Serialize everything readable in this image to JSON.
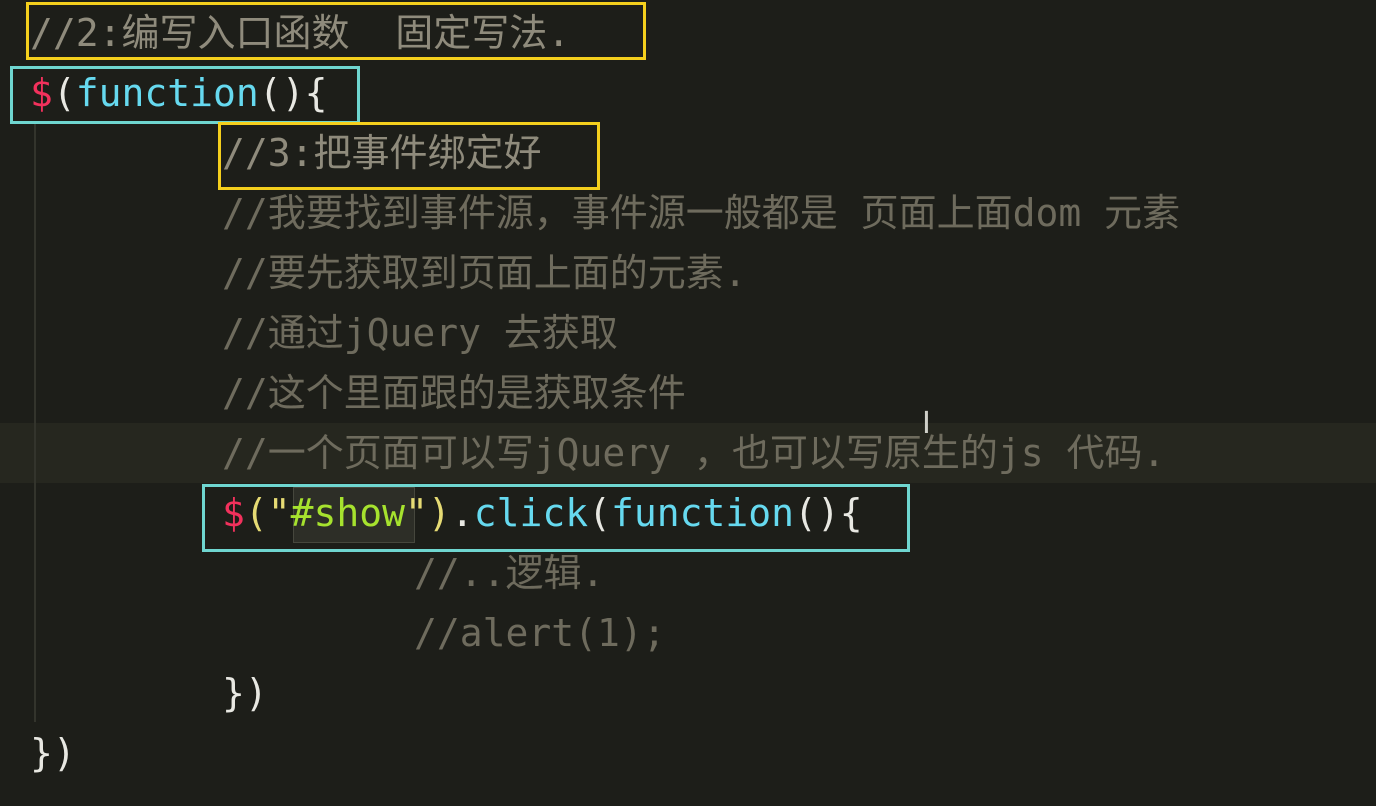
{
  "lines": [
    {
      "text": "//2:编写入口函数  固定写法.",
      "kind": "comment"
    },
    {
      "dollar": "$",
      "open": "(",
      "kw": "function",
      "close": "(){",
      "kind": "code"
    },
    {
      "text": "//3:把事件绑定好",
      "kind": "comment"
    },
    {
      "text": "//我要找到事件源，事件源一般都是 页面上面dom 元素",
      "kind": "comment"
    },
    {
      "text": "//要先获取到页面上面的元素.",
      "kind": "comment"
    },
    {
      "text": "//通过jQuery 去获取",
      "kind": "comment"
    },
    {
      "text": "//这个里面跟的是获取条件",
      "kind": "comment"
    },
    {
      "text": "//一个页面可以写jQuery ，也可以写原生的js 代码.",
      "kind": "comment"
    },
    {
      "dollar": "$",
      "open": "(\"",
      "selector": "#show",
      "close_q": "\")",
      "dot": ".",
      "method": "click",
      "paren": "(",
      "kw": "function",
      "close": "(){",
      "kind": "code"
    },
    {
      "text": "//..逻辑.",
      "kind": "comment"
    },
    {
      "text": "//alert(1);",
      "kind": "comment"
    },
    {
      "text": "})",
      "kind": "code"
    },
    {
      "text": "})",
      "kind": "code"
    }
  ],
  "cursor_glyph": "I"
}
